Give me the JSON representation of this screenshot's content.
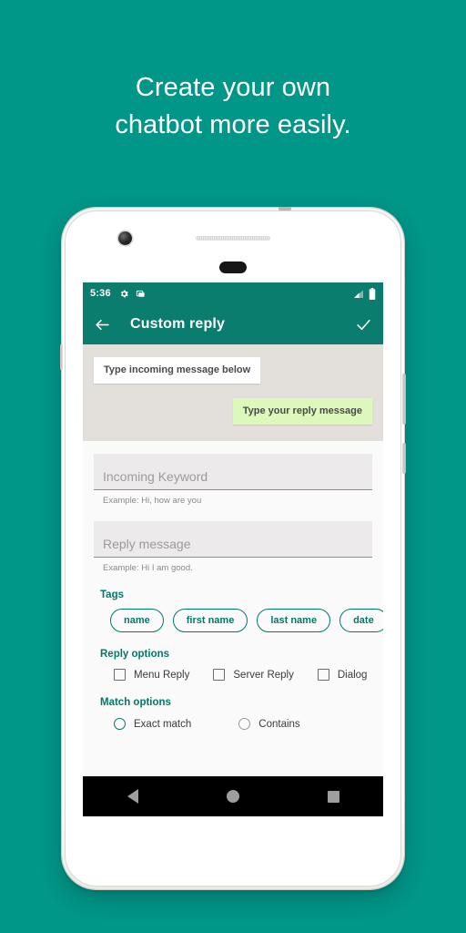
{
  "promo": {
    "headline": "Create your own\nchatbot more easily.",
    "background_color": "#009688"
  },
  "phone": {
    "status_bar": {
      "time": "5:36",
      "left_icons": [
        "gear-icon",
        "screenshot-icon"
      ],
      "right_icons": [
        "signal-icon",
        "battery-icon"
      ],
      "background_color": "#0b7d6e"
    },
    "app_bar": {
      "back_icon": "arrow-left-icon",
      "title": "Custom reply",
      "confirm_icon": "check-icon",
      "background_color": "#0b7d6e"
    },
    "chat_preview": {
      "incoming_bubble": "Type incoming message below",
      "outgoing_bubble": "Type your reply message",
      "background_color": "#e3dfda",
      "outgoing_color": "#dcf8bb"
    },
    "form": {
      "fields": [
        {
          "placeholder": "Incoming Keyword",
          "value": "",
          "helper": "Example: Hi, how are you"
        },
        {
          "placeholder": "Reply message",
          "value": "",
          "helper": "Example: Hi I am good."
        }
      ],
      "tags": {
        "title": "Tags",
        "info_icon": "info-icon",
        "chips": [
          "name",
          "first name",
          "last name",
          "date"
        ]
      },
      "reply_options": {
        "title": "Reply options",
        "items": [
          {
            "label": "Menu Reply",
            "checked": false
          },
          {
            "label": "Server Reply",
            "checked": false
          },
          {
            "label": "Dialog",
            "checked": false
          }
        ]
      },
      "match_options": {
        "title": "Match options",
        "items": [
          {
            "label": "Exact match",
            "selected": true
          },
          {
            "label": "Contains",
            "selected": false
          }
        ]
      },
      "accent_color": "#00796b"
    },
    "nav_bar": {
      "back_icon": "nav-back-icon",
      "home_icon": "nav-home-icon",
      "recents_icon": "nav-recents-icon"
    }
  }
}
